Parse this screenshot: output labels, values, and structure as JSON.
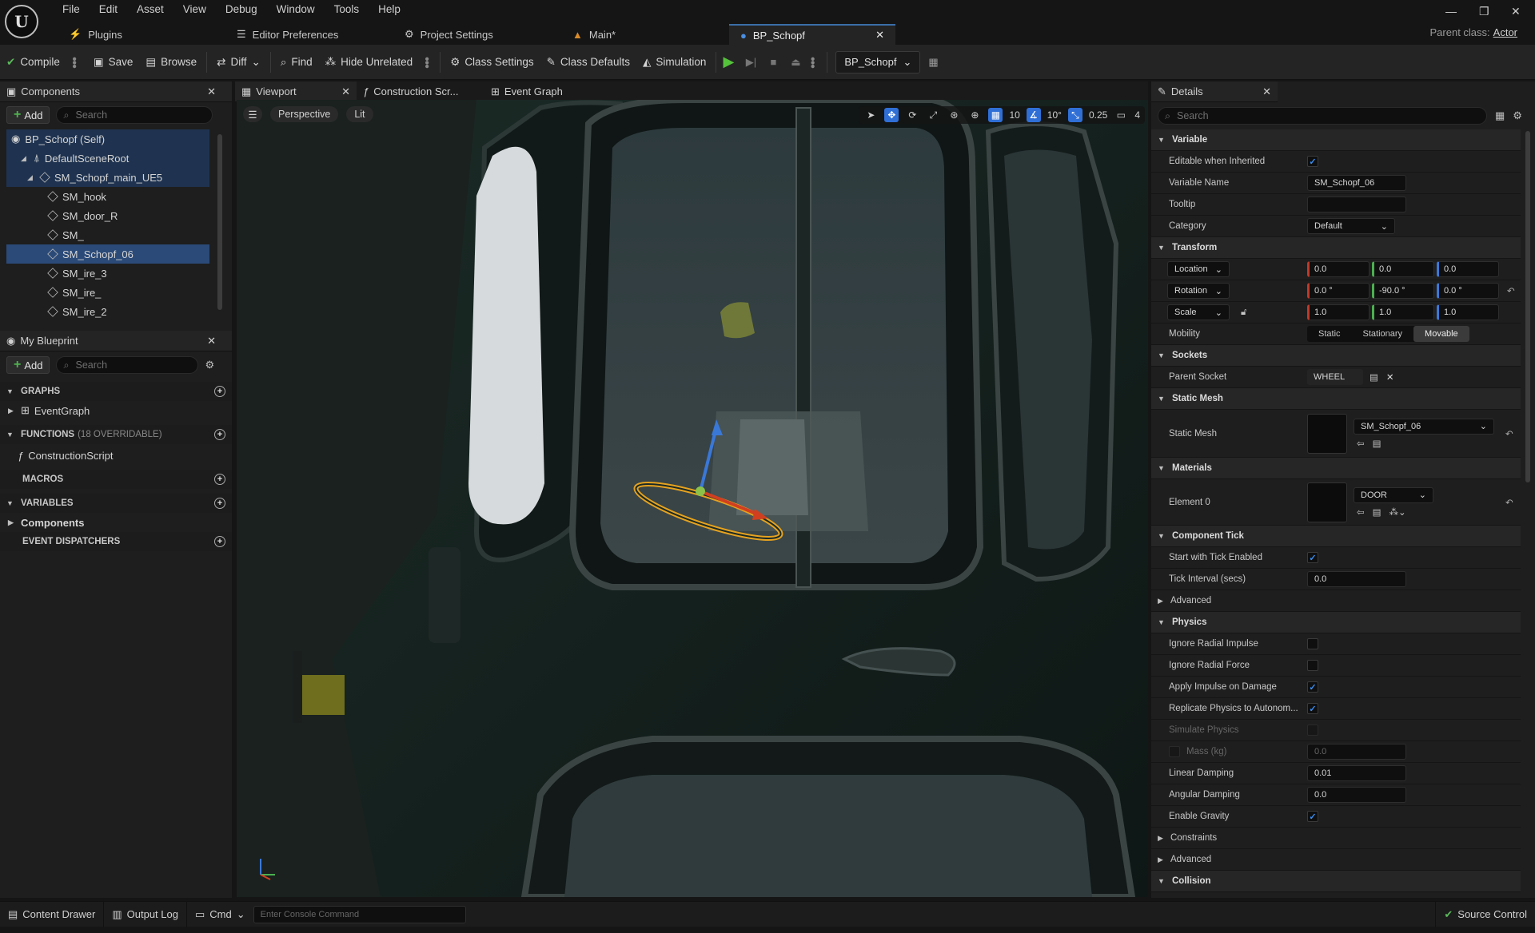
{
  "menu": [
    "File",
    "Edit",
    "Asset",
    "View",
    "Debug",
    "Window",
    "Tools",
    "Help"
  ],
  "doc_tabs": [
    {
      "label": "Plugins",
      "icon": "plug-icon"
    },
    {
      "label": "Editor Preferences",
      "icon": "sliders-icon"
    },
    {
      "label": "Project Settings",
      "icon": "gear-icon"
    },
    {
      "label": "Main*",
      "icon": "level-icon"
    },
    {
      "label": "BP_Schopf",
      "icon": "blueprint-icon"
    }
  ],
  "parent_class": {
    "label": "Parent class:",
    "value": "Actor"
  },
  "toolbar": {
    "compile": "Compile",
    "save": "Save",
    "browse": "Browse",
    "diff": "Diff",
    "find": "Find",
    "hide_unrelated": "Hide Unrelated",
    "class_settings": "Class Settings",
    "class_defaults": "Class Defaults",
    "simulation": "Simulation",
    "debug_object": "BP_Schopf"
  },
  "components": {
    "tab": "Components",
    "add": "Add",
    "search_placeholder": "Search",
    "items": [
      {
        "label": "BP_Schopf (Self)",
        "indent": 0
      },
      {
        "label": "DefaultSceneRoot",
        "indent": 1
      },
      {
        "label": "SM_Schopf_main_UE5",
        "indent": 2
      },
      {
        "label": "SM_hook",
        "indent": 3
      },
      {
        "label": "SM_door_R",
        "indent": 3
      },
      {
        "label": "SM_",
        "indent": 3
      },
      {
        "label": "SM_Schopf_06",
        "indent": 3
      },
      {
        "label": "SM_ire_3",
        "indent": 3
      },
      {
        "label": "SM_ire_",
        "indent": 3
      },
      {
        "label": "SM_ire_2",
        "indent": 3
      }
    ]
  },
  "my_blueprint": {
    "tab": "My Blueprint",
    "add": "Add",
    "search_placeholder": "Search",
    "graphs": "GRAPHS",
    "event_graph": "EventGraph",
    "functions": "FUNCTIONS",
    "functions_note": "(18 OVERRIDABLE)",
    "construction_script": "ConstructionScript",
    "macros": "MACROS",
    "variables": "VARIABLES",
    "components": "Components",
    "event_dispatchers": "EVENT DISPATCHERS"
  },
  "editor_tabs": [
    "Viewport",
    "Construction Scr...",
    "Event Graph"
  ],
  "viewport": {
    "perspective": "Perspective",
    "lit": "Lit",
    "grid": "10",
    "angle": "10°",
    "scale": "0.25",
    "camera": "4"
  },
  "details": {
    "tab": "Details",
    "search_placeholder": "Search",
    "variable": {
      "header": "Variable",
      "editable_label": "Editable when Inherited",
      "name_label": "Variable Name",
      "name_value": "SM_Schopf_06",
      "tooltip_label": "Tooltip",
      "tooltip_value": "",
      "category_label": "Category",
      "category_value": "Default"
    },
    "transform": {
      "header": "Transform",
      "location": "Location",
      "rotation": "Rotation",
      "scale": "Scale",
      "location_values": [
        "0.0",
        "0.0",
        "0.0"
      ],
      "rotation_values": [
        "0.0 °",
        "-90.0 °",
        "0.0 °"
      ],
      "scale_values": [
        "1.0",
        "1.0",
        "1.0"
      ],
      "mobility_label": "Mobility",
      "mobility_options": [
        "Static",
        "Stationary",
        "Movable"
      ]
    },
    "sockets": {
      "header": "Sockets",
      "parent_socket_label": "Parent Socket",
      "parent_socket_value": "WHEEL"
    },
    "static_mesh": {
      "header": "Static Mesh",
      "label": "Static Mesh",
      "value": "SM_Schopf_06"
    },
    "materials": {
      "header": "Materials",
      "label": "Element 0",
      "value": "DOOR"
    },
    "component_tick": {
      "header": "Component Tick",
      "start_label": "Start with Tick Enabled",
      "interval_label": "Tick Interval (secs)",
      "interval_value": "0.0",
      "advanced": "Advanced"
    },
    "physics": {
      "header": "Physics",
      "ignore_radial_impulse": "Ignore Radial Impulse",
      "ignore_radial_force": "Ignore Radial Force",
      "apply_impulse": "Apply Impulse on Damage",
      "replicate": "Replicate Physics to Autonom...",
      "simulate": "Simulate Physics",
      "mass_label": "Mass (kg)",
      "mass_value": "0.0",
      "linear_label": "Linear Damping",
      "linear_value": "0.01",
      "angular_label": "Angular Damping",
      "angular_value": "0.0",
      "gravity_label": "Enable Gravity"
    },
    "constraints": "Constraints",
    "advanced2": "Advanced",
    "collision": "Collision"
  },
  "statusbar": {
    "content_drawer": "Content Drawer",
    "output_log": "Output Log",
    "cmd": "Cmd",
    "console_placeholder": "Enter Console Command",
    "source_control": "Source Control"
  }
}
